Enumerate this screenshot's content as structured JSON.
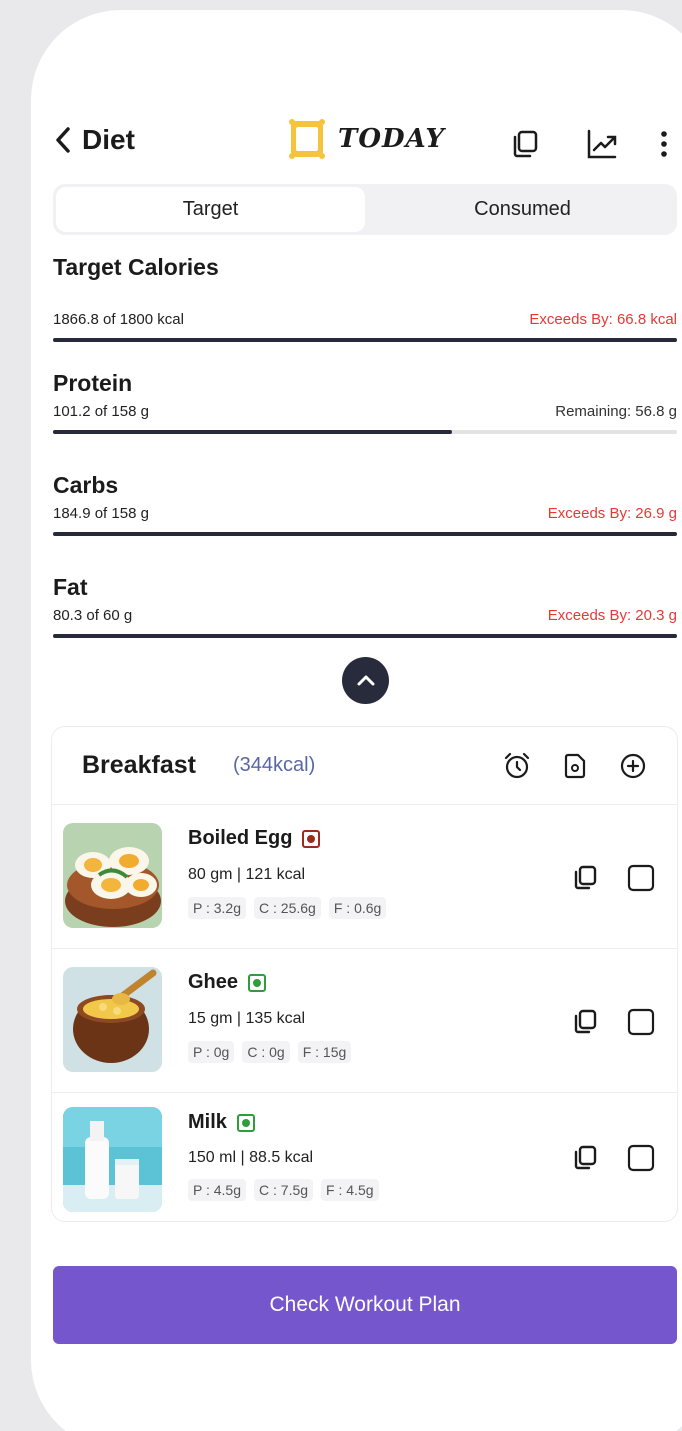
{
  "header": {
    "back_label": "Diet",
    "today_label": "TODAY"
  },
  "tabs": [
    {
      "label": "Target",
      "active": true
    },
    {
      "label": "Consumed",
      "active": false
    }
  ],
  "macros": [
    {
      "title": "Target Calories",
      "progress": "1866.8 of 1800 kcal",
      "status": "Exceeds By: 66.8 kcal",
      "exceeds": true,
      "fill_fraction": 1.0
    },
    {
      "title": "Protein",
      "progress": "101.2 of 158 g",
      "status": "Remaining: 56.8 g",
      "exceeds": false,
      "fill_fraction": 0.64
    },
    {
      "title": "Carbs",
      "progress": "184.9 of 158 g",
      "status": "Exceeds By: 26.9 g",
      "exceeds": true,
      "fill_fraction": 1.0
    },
    {
      "title": "Fat",
      "progress": "80.3 of 60 g",
      "status": "Exceeds By: 20.3 g",
      "exceeds": true,
      "fill_fraction": 1.0
    }
  ],
  "meal": {
    "title": "Breakfast",
    "kcal": "(344kcal)",
    "items": [
      {
        "name": "Boiled Egg",
        "diet": "non-veg",
        "qty": "80 gm | 121 kcal",
        "p": "P : 3.2g",
        "c": "C : 25.6g",
        "f": "F : 0.6g"
      },
      {
        "name": "Ghee",
        "diet": "veg",
        "qty": "15 gm | 135 kcal",
        "p": "P : 0g",
        "c": "C : 0g",
        "f": "F : 15g"
      },
      {
        "name": "Milk",
        "diet": "veg",
        "qty": "150 ml | 88.5 kcal",
        "p": "P : 4.5g",
        "c": "C : 7.5g",
        "f": "F : 4.5g"
      }
    ]
  },
  "cta_label": "Check Workout Plan",
  "colors": {
    "accent": "#7556cd",
    "exceeds": "#e53935",
    "bar": "#25293a",
    "veg": "#2e9d3a",
    "non_veg": "#9b2b1f"
  }
}
